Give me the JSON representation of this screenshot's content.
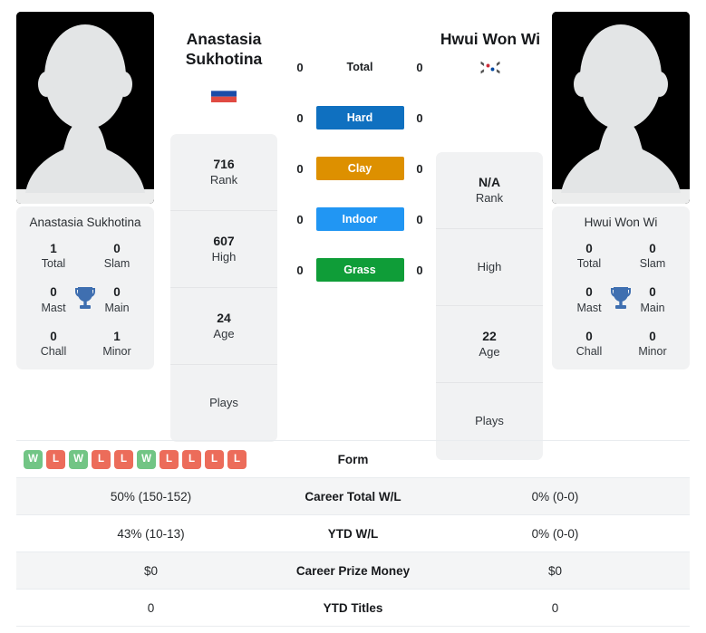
{
  "players": {
    "left": {
      "name": "Anastasia Sukhotina",
      "display_name_line1": "Anastasia",
      "display_name_line2": "Sukhotina",
      "flag": "russia-flag",
      "photo": "player-avatar-placeholder",
      "titles": [
        {
          "num": "1",
          "label": "Total"
        },
        {
          "num": "0",
          "label": "Slam"
        },
        {
          "num": "0",
          "label": "Mast"
        },
        {
          "num": "0",
          "label": "Main"
        },
        {
          "num": "0",
          "label": "Chall"
        },
        {
          "num": "1",
          "label": "Minor"
        }
      ],
      "info": [
        {
          "value": "716",
          "label": "Rank"
        },
        {
          "value": "607",
          "label": "High"
        },
        {
          "value": "24",
          "label": "Age"
        },
        {
          "value": "",
          "label": "Plays"
        }
      ],
      "surfaces": {
        "total": "0",
        "hard": "0",
        "clay": "0",
        "indoor": "0",
        "grass": "0"
      }
    },
    "right": {
      "name": "Hwui Won Wi",
      "display_name_line1": "Hwui Won Wi",
      "display_name_line2": "",
      "flag": "south-korea-flag",
      "photo": "player-avatar-placeholder",
      "titles": [
        {
          "num": "0",
          "label": "Total"
        },
        {
          "num": "0",
          "label": "Slam"
        },
        {
          "num": "0",
          "label": "Mast"
        },
        {
          "num": "0",
          "label": "Main"
        },
        {
          "num": "0",
          "label": "Chall"
        },
        {
          "num": "0",
          "label": "Minor"
        }
      ],
      "info": [
        {
          "value": "N/A",
          "label": "Rank"
        },
        {
          "value": "",
          "label": "High"
        },
        {
          "value": "22",
          "label": "Age"
        },
        {
          "value": "",
          "label": "Plays"
        }
      ],
      "surfaces": {
        "total": "0",
        "hard": "0",
        "clay": "0",
        "indoor": "0",
        "grass": "0"
      }
    }
  },
  "surface_rows": [
    {
      "key": "total",
      "label": "Total",
      "color": "transparent"
    },
    {
      "key": "hard",
      "label": "Hard",
      "color": "#0f70c0"
    },
    {
      "key": "clay",
      "label": "Clay",
      "color": "#dd9000"
    },
    {
      "key": "indoor",
      "label": "Indoor",
      "color": "#2196f3"
    },
    {
      "key": "grass",
      "label": "Grass",
      "color": "#0f9d38"
    }
  ],
  "table": {
    "rows": [
      {
        "label": "Form",
        "left": "",
        "right": "",
        "type": "form"
      },
      {
        "label": "Career Total W/L",
        "left": "50% (150-152)",
        "right": "0% (0-0)",
        "type": "text"
      },
      {
        "label": "YTD W/L",
        "left": "43% (10-13)",
        "right": "0% (0-0)",
        "type": "text"
      },
      {
        "label": "Career Prize Money",
        "left": "$0",
        "right": "$0",
        "type": "text"
      },
      {
        "label": "YTD Titles",
        "left": "0",
        "right": "0",
        "type": "text"
      }
    ],
    "form_left": [
      "W",
      "L",
      "W",
      "L",
      "L",
      "W",
      "L",
      "L",
      "L",
      "L"
    ],
    "form_right": []
  },
  "colors": {
    "hard": "#0f70c0",
    "clay": "#dd9000",
    "indoor": "#2196f3",
    "grass": "#0f9d38",
    "win_badge": "#72c585",
    "loss_badge": "#ec6c5a",
    "card_bg": "#f1f2f3",
    "alt_row_bg": "#f4f5f6"
  }
}
